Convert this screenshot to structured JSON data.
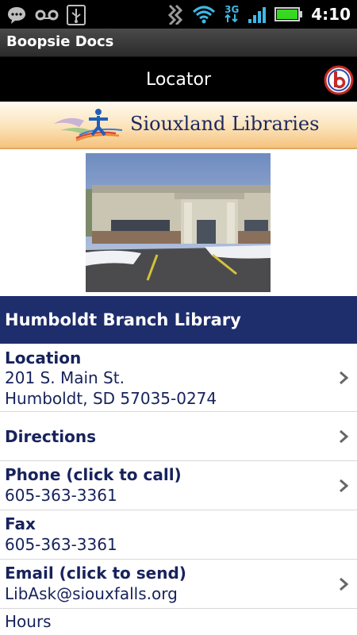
{
  "status_bar": {
    "time": "4:10",
    "network": "3G",
    "icons": [
      "chat-icon",
      "voicemail-icon",
      "usb-icon",
      "vibrate-icon",
      "wifi-icon",
      "signal-icon",
      "battery-icon"
    ]
  },
  "app": {
    "title": "Boopsie Docs"
  },
  "nav": {
    "title": "Locator"
  },
  "banner": {
    "text": "Siouxland Libraries"
  },
  "branch": {
    "name": "Humboldt Branch Library"
  },
  "details": [
    {
      "label": "Location",
      "lines": [
        "201 S. Main St.",
        "Humboldt, SD 57035-0274"
      ],
      "action": true
    },
    {
      "label": "Directions",
      "lines": [],
      "action": true
    },
    {
      "label": "Phone (click to call)",
      "lines": [
        "605-363-3361"
      ],
      "action": true
    },
    {
      "label": "Fax",
      "lines": [
        "605-363-3361"
      ],
      "action": false
    },
    {
      "label": "Email (click to send)",
      "lines": [
        "LibAsk@siouxfalls.org"
      ],
      "action": true
    },
    {
      "label": "",
      "lines": [
        "Hours"
      ],
      "action": false
    }
  ],
  "colors": {
    "accent": "#1e2d6c",
    "text": "#17225c",
    "battery": "#36d91f"
  }
}
